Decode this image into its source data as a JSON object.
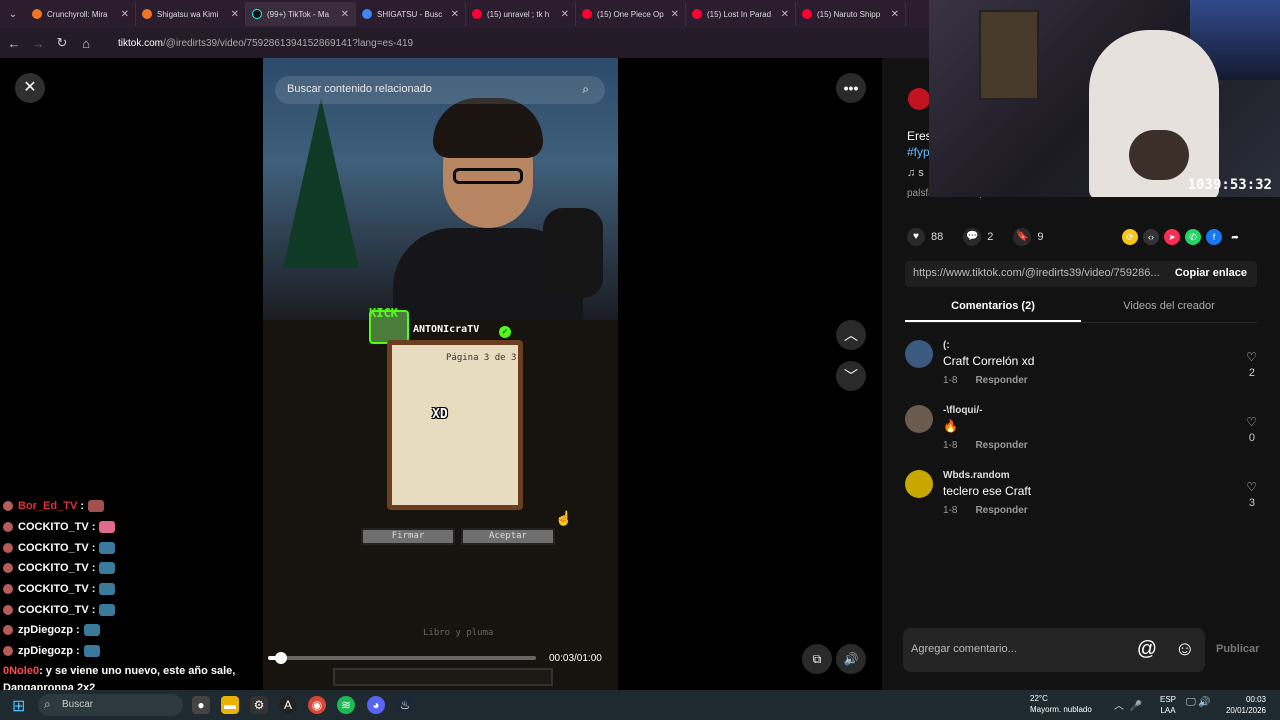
{
  "browser": {
    "tabs": [
      {
        "label": "Crunchyroll: Mira",
        "color": "#f47521"
      },
      {
        "label": "Shigatsu wa Kimi",
        "color": "#f47521"
      },
      {
        "label": "(99+) TikTok - Ma",
        "color": "#111111"
      },
      {
        "label": "SHIGATSU - Busc",
        "color": "#4285f4"
      },
      {
        "label": "(15) unravel ; tk h",
        "color": "#ff0033"
      },
      {
        "label": "(15) One Piece Op",
        "color": "#ff0033"
      },
      {
        "label": "(15) Lost In Parad",
        "color": "#ff0033"
      },
      {
        "label": "(15) Naruto Shipp",
        "color": "#ff0033"
      }
    ],
    "url_host": "tiktok.com",
    "url_path": "/@iredirts39/video/7592861394152869141?lang=es-419"
  },
  "video": {
    "search_placeholder": "Buscar contenido relacionado",
    "kick_label": "KICK",
    "streamer_name": "ANTONIcraTV",
    "book_page": "Página 3 de 3",
    "book_text": "XD",
    "btn_sign": "Firmar",
    "btn_accept": "Aceptar",
    "book_label": "Libro y pluma",
    "time": "00:03/01:00",
    "progress": 0.05
  },
  "panel": {
    "desc_line1": "Eres",
    "desc_hashtag": "#fyp",
    "desc_music": "♫ s",
    "shared_text": "palsfazt9 lo compartió",
    "likes": "88",
    "comments_count": "2",
    "saves": "9",
    "link_url": "https://www.tiktok.com/@iredirts39/video/759286...",
    "copy_label": "Copiar enlace",
    "tab_comments": "Comentarios (2)",
    "tab_creator": "Videos del creador",
    "comments": [
      {
        "user": "(:",
        "text": "Craft Correlón xd",
        "date": "1-8",
        "reply": "Responder",
        "likes": "2",
        "avatar_color": "#3b5a80"
      },
      {
        "user": "-\\floqui/-",
        "text": "🔥",
        "date": "1-8",
        "reply": "Responder",
        "likes": "0",
        "avatar_color": "#6b5a4e"
      },
      {
        "user": "Wbds.random",
        "text": "teclero ese Craft",
        "date": "1-8",
        "reply": "Responder",
        "likes": "3",
        "avatar_color": "#c8a700"
      }
    ],
    "input_placeholder": "Agregar comentario...",
    "publish_label": "Publicar"
  },
  "webcam": {
    "uptime": "1039:53:32"
  },
  "chat": {
    "lines": [
      {
        "user": "Bor_Ed_TV",
        "color": "#e0303a"
      },
      {
        "user": "COCKITO_TV",
        "color": "#ffffff"
      },
      {
        "user": "COCKITO_TV",
        "color": "#ffffff"
      },
      {
        "user": "COCKITO_TV",
        "color": "#ffffff"
      },
      {
        "user": "COCKITO_TV",
        "color": "#ffffff"
      },
      {
        "user": "COCKITO_TV",
        "color": "#ffffff"
      },
      {
        "user": "zpDiegozp",
        "color": "#ffffff"
      },
      {
        "user": "zpDiegozp",
        "color": "#ffffff"
      }
    ],
    "last_user": "0Nole0",
    "last_message": ": y se viene uno nuevo, este año sale,",
    "last_message_2": "Danganronpa 2x2"
  },
  "taskbar": {
    "search_label": "Buscar",
    "weather_temp": "22°C",
    "weather_desc": "Mayorm. nublado",
    "lang": "ESP",
    "lang_sub": "LAA",
    "time": "00:03",
    "date": "20/01/2026"
  }
}
